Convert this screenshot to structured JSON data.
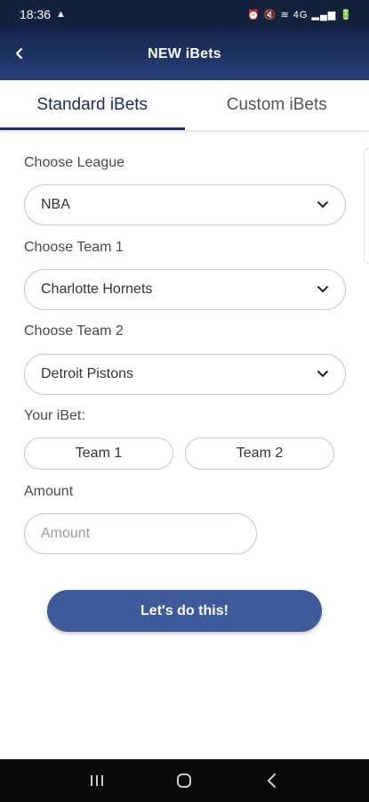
{
  "status_bar": {
    "time": "18:36",
    "indicators": "⏰ 🔇 ≋ 4G ▂▄▆ 🔋"
  },
  "header": {
    "title": "NEW iBets"
  },
  "tabs": [
    {
      "label": "Standard iBets",
      "active": true
    },
    {
      "label": "Custom iBets",
      "active": false
    }
  ],
  "form": {
    "league_label": "Choose League",
    "league_value": "NBA",
    "team1_label": "Choose Team 1",
    "team1_value": "Charlotte Hornets",
    "team2_label": "Choose Team 2",
    "team2_value": "Detroit Pistons",
    "ibet_label": "Your iBet:",
    "ibet_options": [
      "Team 1",
      "Team 2"
    ],
    "amount_label": "Amount",
    "amount_placeholder": "Amount",
    "submit_label": "Let's do this!"
  },
  "colors": {
    "header_bg": "#1f3566",
    "accent": "#3d5a99",
    "tab_indicator": "#1e2f6a"
  }
}
